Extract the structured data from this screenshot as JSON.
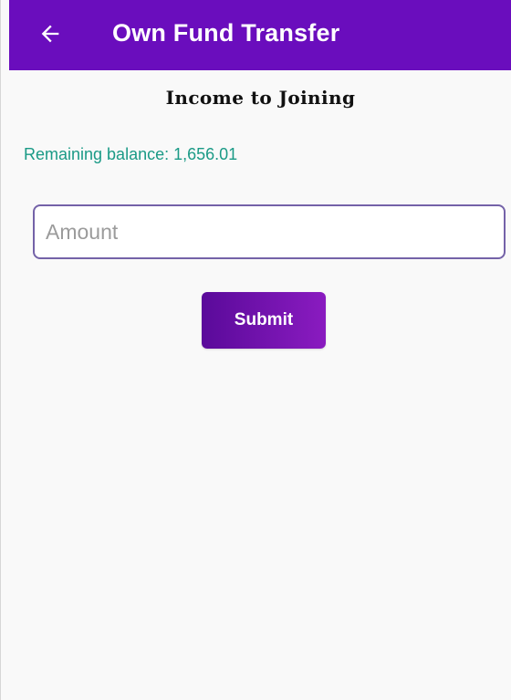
{
  "app_bar": {
    "title": "Own Fund Transfer",
    "back_icon": "arrow-left-icon",
    "background_color": "#6a0dbd"
  },
  "form": {
    "section_title": "Income to Joining",
    "balance_label": "Remaining balance: 1,656.01",
    "amount_placeholder": "Amount",
    "amount_value": "",
    "submit_label": "Submit"
  },
  "colors": {
    "balance_text": "#1a9a86",
    "input_border": "#7462a8",
    "button_gradient_start": "#5a0a9a",
    "button_gradient_end": "#8a1bc0"
  }
}
